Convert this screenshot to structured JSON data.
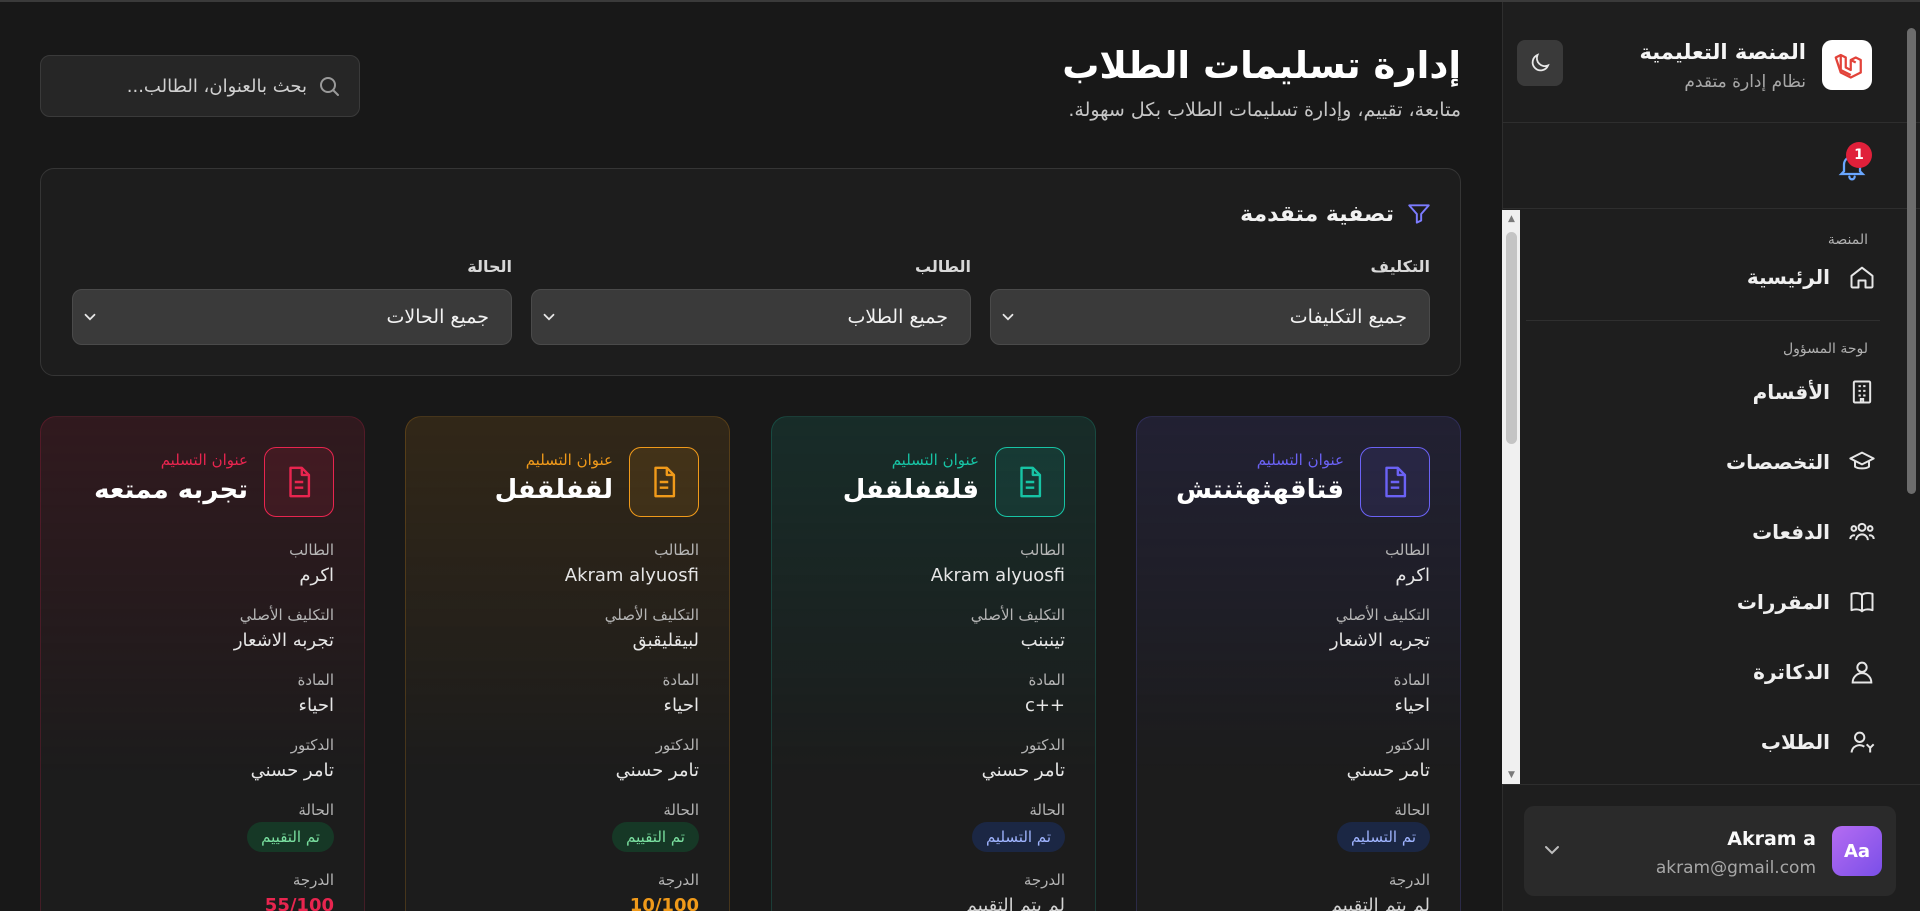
{
  "app": {
    "name": "المنصة التعليمية",
    "subtitle": "نظام إدارة متقدم",
    "notification_count": "1"
  },
  "sidebar": {
    "sections": [
      {
        "label": "المنصة",
        "items": [
          {
            "label": "الرئيسية",
            "icon": "home-icon"
          }
        ]
      },
      {
        "label": "لوحة المسؤول",
        "items": [
          {
            "label": "الأقسام",
            "icon": "building-icon"
          },
          {
            "label": "التخصصات",
            "icon": "graduation-cap-icon"
          },
          {
            "label": "الدفعات",
            "icon": "users-group-icon"
          },
          {
            "label": "المقررات",
            "icon": "book-icon"
          },
          {
            "label": "الدكاترة",
            "icon": "user-icon"
          },
          {
            "label": "الطلاب",
            "icon": "students-icon"
          }
        ]
      }
    ]
  },
  "user": {
    "initials": "Aa",
    "name": "Akram a",
    "email": "akram@gmail.com"
  },
  "header": {
    "title": "إدارة تسليمات الطلاب",
    "subtitle": "متابعة، تقييم، وإدارة تسليمات الطلاب بكل سهولة.",
    "search_placeholder": "بحث بالعنوان، الطالب..."
  },
  "filters": {
    "title": "تصفية متقدمة",
    "assignment": {
      "label": "التكليف",
      "value": "جميع التكليفات"
    },
    "student": {
      "label": "الطالب",
      "value": "جميع الطلاب"
    },
    "status": {
      "label": "الحالة",
      "value": "جميع الحالات"
    }
  },
  "field_labels": {
    "submission_title": "عنوان التسليم",
    "student": "الطالب",
    "original_assignment": "التكليف الأصلي",
    "subject": "المادة",
    "doctor": "الدكتور",
    "status": "الحالة",
    "grade": "الدرجة"
  },
  "cards": [
    {
      "accent": "#6b62f5",
      "title": "قتاقهثهثنتش",
      "student": "اكرم",
      "assignment": "تجربه الاشعار",
      "subject": "احياء",
      "doctor": "تامر حسني",
      "status": "تم التسليم",
      "status_color": "#9fb4ff",
      "grade": "لم يتم التقييم"
    },
    {
      "accent": "#17c4a5",
      "title": "قلقفلقفل",
      "student": "Akram alyuosfi",
      "assignment": "تينبنب",
      "subject": "c++",
      "doctor": "تامر حسني",
      "status": "تم التسليم",
      "status_color": "#9fb4ff",
      "grade": "لم يتم التقييم"
    },
    {
      "accent": "#f09a1a",
      "title": "لقفلقفل",
      "student": "Akram alyuosfi",
      "assignment": "لبيقليقبق",
      "subject": "احياء",
      "doctor": "تامر حسني",
      "status": "تم التقييم",
      "status_color": "#7ae0a0",
      "grade": "10/100"
    },
    {
      "accent": "#e8254f",
      "title": "تجربه ممتعه",
      "student": "اكرم",
      "assignment": "تجربه الاشعار",
      "subject": "احياء",
      "doctor": "تامر حسني",
      "status": "تم التقييم",
      "status_color": "#7ae0a0",
      "grade": "55/100"
    }
  ]
}
